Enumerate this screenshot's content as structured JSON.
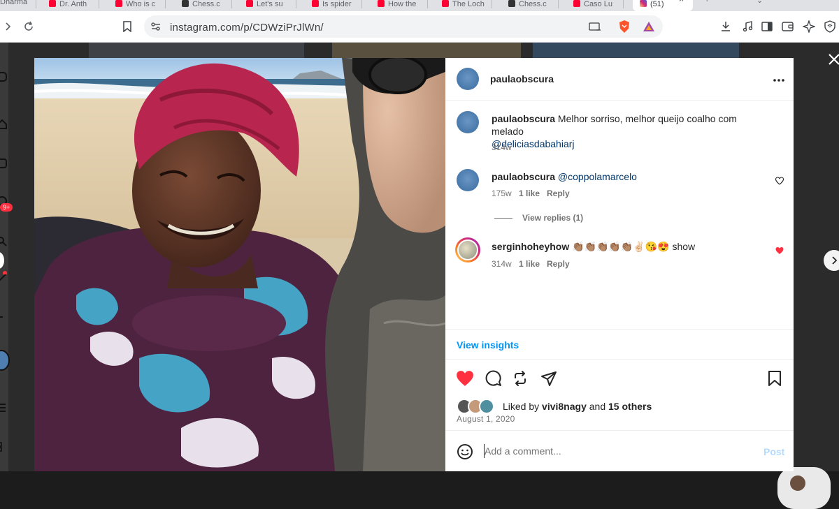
{
  "browser": {
    "tabs": [
      {
        "label": "Dharma",
        "color": "#9e9e9e"
      },
      {
        "label": "Dr. Anth",
        "color": "#ff0033"
      },
      {
        "label": "Who is c",
        "color": "#ff0033"
      },
      {
        "label": "Chess.c",
        "color": "#333333"
      },
      {
        "label": "Let's su",
        "color": "#ff0033"
      },
      {
        "label": "Is spider",
        "color": "#ff0033"
      },
      {
        "label": "How the",
        "color": "#ff0033"
      },
      {
        "label": "The Loch",
        "color": "#ff0033"
      },
      {
        "label": "Chess.c",
        "color": "#333333"
      },
      {
        "label": "Caso Lu",
        "color": "#ff0033"
      }
    ],
    "active_tab": {
      "label": "(51)",
      "close": "×"
    },
    "url": "instagram.com/p/CDWziPrJlWn/"
  },
  "background": {
    "notification_badge": "9+"
  },
  "post": {
    "author": "paulaobscura",
    "more_icon": "more-horizontal-icon",
    "caption": {
      "username": "paulaobscura",
      "text": "Melhor sorriso, melhor queijo coalho com melado",
      "mention": "@deliciasdabahiarj",
      "time": "314w"
    },
    "comments": [
      {
        "username": "paulaobscura",
        "mention": "@coppolamarcelo",
        "time": "175w",
        "likes": "1 like",
        "reply": "Reply",
        "liked": false
      },
      {
        "username": "serginhoheyhow",
        "text": "👏🏽👏🏽👏🏽👏🏽👏🏽✌🏻😘😍 show",
        "time": "314w",
        "likes": "1 like",
        "reply": "Reply",
        "liked": true
      }
    ],
    "view_replies": "View replies (1)",
    "view_insights": "View insights",
    "liked_by": {
      "prefix": "Liked by",
      "user": "vivi8nagy",
      "and": "and",
      "others": "15 others"
    },
    "date": "August 1, 2020",
    "comment_placeholder": "Add a comment...",
    "post_button": "Post"
  },
  "colors": {
    "like_red": "#ff3040",
    "link_blue": "#0095f6",
    "mention_blue": "#00376b"
  }
}
